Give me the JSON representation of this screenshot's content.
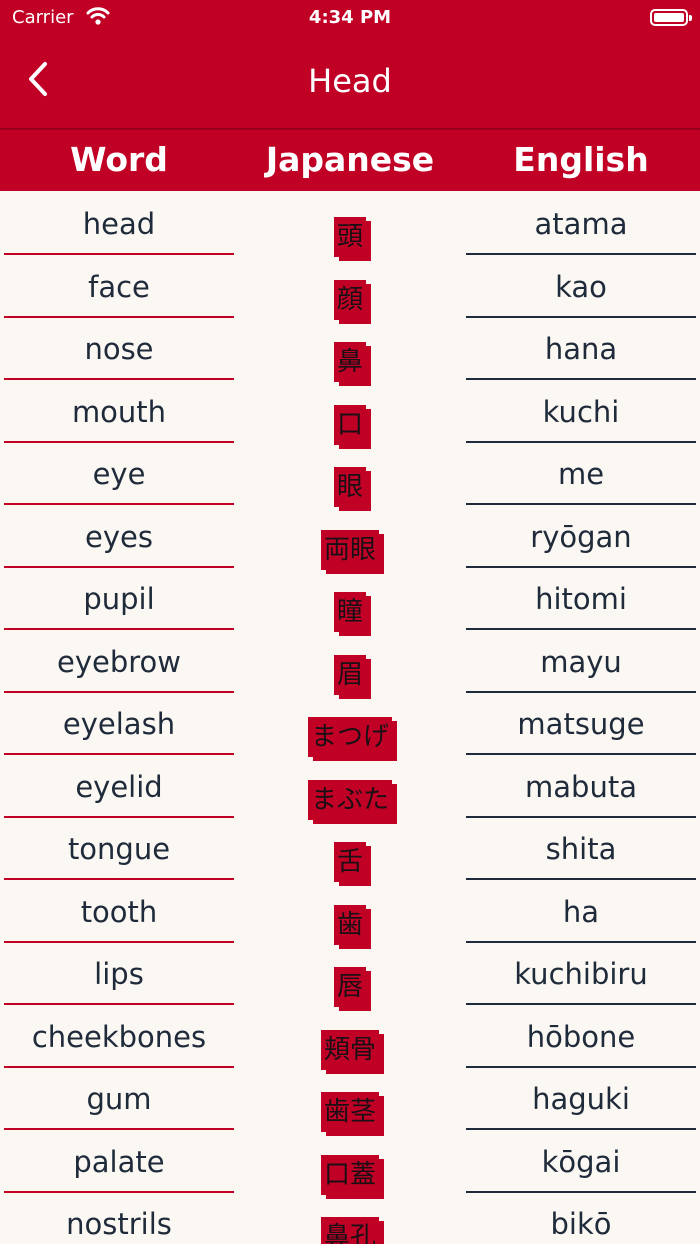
{
  "status_bar": {
    "carrier": "Carrier",
    "time": "4:34 PM"
  },
  "nav": {
    "title": "Head",
    "back_icon": "chevron-left-icon"
  },
  "columns": {
    "word": "Word",
    "japanese": "Japanese",
    "english": "English"
  },
  "rows": [
    {
      "word": "head",
      "japanese": "頭",
      "romaji": "atama"
    },
    {
      "word": "face",
      "japanese": "顔",
      "romaji": "kao"
    },
    {
      "word": "nose",
      "japanese": "鼻",
      "romaji": "hana"
    },
    {
      "word": "mouth",
      "japanese": "口",
      "romaji": "kuchi"
    },
    {
      "word": "eye",
      "japanese": "眼",
      "romaji": "me"
    },
    {
      "word": "eyes",
      "japanese": "両眼",
      "romaji": "ryōgan"
    },
    {
      "word": "pupil",
      "japanese": "瞳",
      "romaji": "hitomi"
    },
    {
      "word": "eyebrow",
      "japanese": "眉",
      "romaji": "mayu"
    },
    {
      "word": "eyelash",
      "japanese": "まつげ",
      "romaji": "matsuge"
    },
    {
      "word": "eyelid",
      "japanese": "まぶた",
      "romaji": "mabuta"
    },
    {
      "word": "tongue",
      "japanese": "舌",
      "romaji": "shita"
    },
    {
      "word": "tooth",
      "japanese": "歯",
      "romaji": "ha"
    },
    {
      "word": "lips",
      "japanese": "唇",
      "romaji": "kuchibiru"
    },
    {
      "word": "cheekbones",
      "japanese": "頬骨",
      "romaji": "hōbone"
    },
    {
      "word": "gum",
      "japanese": "歯茎",
      "romaji": "haguki"
    },
    {
      "word": "palate",
      "japanese": "口蓋",
      "romaji": "kōgai"
    },
    {
      "word": "nostrils",
      "japanese": "鼻孔",
      "romaji": "bikō"
    }
  ],
  "colors": {
    "accent": "#c10026",
    "background": "#fbf8f3",
    "text": "#1f2a3a"
  }
}
